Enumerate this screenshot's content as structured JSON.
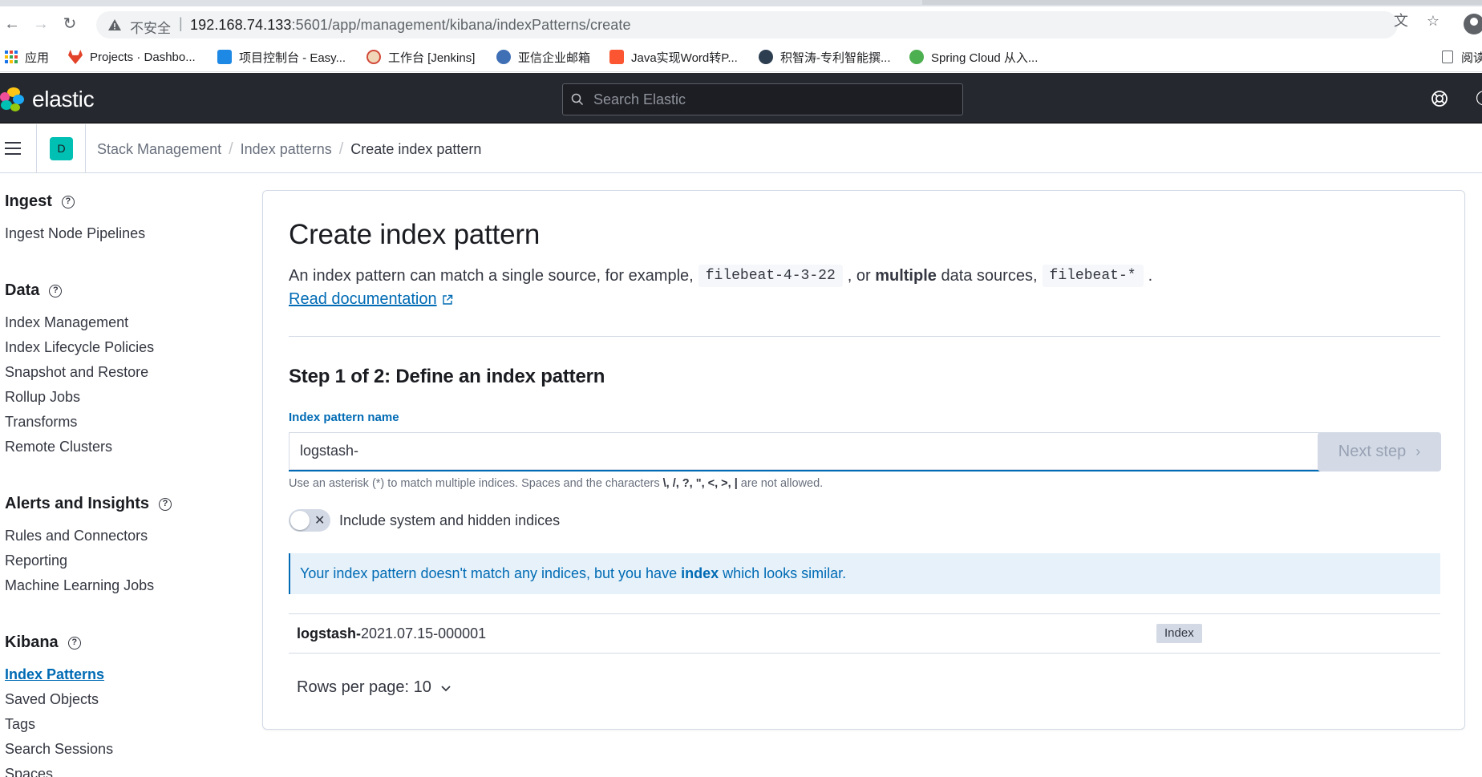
{
  "browser": {
    "insecure_label": "不安全",
    "url_host": "192.168.74.133",
    "url_rest": ":5601/app/management/kibana/indexPatterns/create",
    "bookmarks": [
      {
        "label": "应用",
        "icon": "apps-grid-icon"
      },
      {
        "label": "Projects · Dashbo...",
        "icon": "gitlab-icon",
        "color": "#e24329"
      },
      {
        "label": "项目控制台 - Easy...",
        "icon": "easy-icon",
        "color": "#1e88e5"
      },
      {
        "label": "工作台 [Jenkins]",
        "icon": "jenkins-icon",
        "color": "#d24939"
      },
      {
        "label": "亚信企业邮箱",
        "icon": "mail-icon",
        "color": "#3f6fb5"
      },
      {
        "label": "Java实现Word转P...",
        "icon": "csdn-icon",
        "color": "#fc5531"
      },
      {
        "label": "积智涛-专利智能撰...",
        "icon": "robot-icon",
        "color": "#2c3e50"
      },
      {
        "label": "Spring Cloud 从入...",
        "icon": "avatar-icon",
        "color": "#4caf50"
      }
    ],
    "reading_list_label": "阅读"
  },
  "header": {
    "logo_text": "elastic",
    "search_placeholder": "Search Elastic"
  },
  "breadcrumb": {
    "space_initial": "D",
    "items": [
      "Stack Management",
      "Index patterns",
      "Create index pattern"
    ]
  },
  "sidebar": {
    "sections": [
      {
        "title": "Ingest",
        "items": [
          "Ingest Node Pipelines"
        ]
      },
      {
        "title": "Data",
        "items": [
          "Index Management",
          "Index Lifecycle Policies",
          "Snapshot and Restore",
          "Rollup Jobs",
          "Transforms",
          "Remote Clusters"
        ]
      },
      {
        "title": "Alerts and Insights",
        "items": [
          "Rules and Connectors",
          "Reporting",
          "Machine Learning Jobs"
        ]
      },
      {
        "title": "Kibana",
        "items": [
          "Index Patterns",
          "Saved Objects",
          "Tags",
          "Search Sessions",
          "Spaces"
        ]
      }
    ],
    "active_item": "Index Patterns"
  },
  "main": {
    "title": "Create index pattern",
    "intro_prefix": "An index pattern can match a single source, for example,",
    "example_single": "filebeat-4-3-22",
    "intro_middle_1": ", or",
    "intro_bold": "multiple",
    "intro_middle_2": "data sources,",
    "example_multi": "filebeat-*",
    "intro_suffix": ".",
    "doc_link": "Read documentation",
    "step_title": "Step 1 of 2: Define an index pattern",
    "field_label": "Index pattern name",
    "field_value": "logstash-",
    "next_button": "Next step",
    "help_prefix": "Use an asterisk (*) to match multiple indices. Spaces and the characters",
    "help_chars": "\\, /, ?, \", <, >, |",
    "help_suffix": "are not allowed.",
    "toggle_label": "Include system and hidden indices",
    "toggle_on": false,
    "callout_prefix": "Your index pattern doesn't match any indices, but you have",
    "callout_bold": "index",
    "callout_suffix": "which looks similar.",
    "results": [
      {
        "match": "logstash-",
        "rest": "2021.07.15-000001",
        "type": "Index"
      }
    ],
    "rows_per_page_label": "Rows per page: 10"
  },
  "colors": {
    "header_bg": "#25282f",
    "accent": "#006bb4",
    "space_avatar": "#00bfb3"
  }
}
